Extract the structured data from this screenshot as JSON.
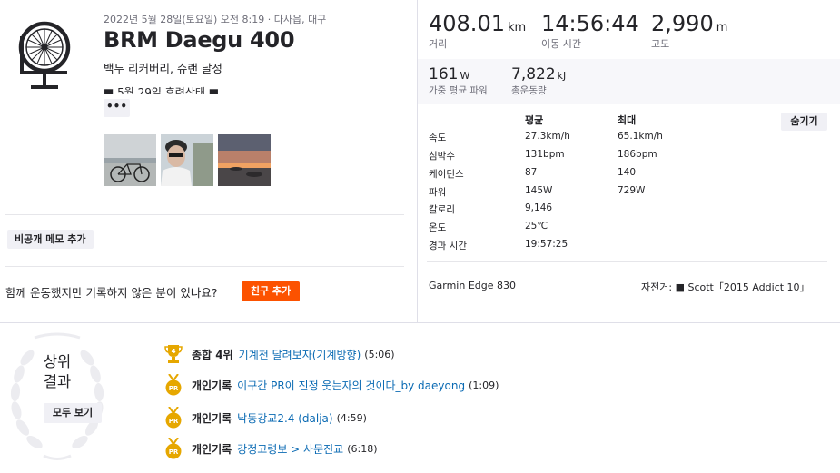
{
  "activity": {
    "datetime": "2022년 5월 28일(토요일) 오전 8:19 · 다사읍, 대구",
    "title": "BRM Daegu 400",
    "desc_line1": "백두 리커버리, 슈랜 달성",
    "desc_line2": "■ 5월 29일 후련상태 ■",
    "more_label": "•••",
    "private_note_label": "비공개 메모 추가",
    "together_text": "함께 운동했지만 기록하지 않은 분이 있나요?",
    "add_friend_label": "친구 추가"
  },
  "stats_primary": [
    {
      "value": "408.01",
      "unit": "km",
      "label": "거리"
    },
    {
      "value": "14:56:44",
      "unit": "",
      "label": "이동 시간"
    },
    {
      "value": "2,990",
      "unit": "m",
      "label": "고도"
    }
  ],
  "stats_secondary": [
    {
      "value": "161",
      "unit": "W",
      "label": "가중 평균 파워"
    },
    {
      "value": "7,822",
      "unit": "kJ",
      "label": "총운동량"
    }
  ],
  "details": {
    "hide_label": "숨기기",
    "headers": {
      "avg": "평균",
      "max": "최대"
    },
    "rows": [
      {
        "name": "속도",
        "avg": "27.3km/h",
        "max": "65.1km/h"
      },
      {
        "name": "심박수",
        "avg": "131bpm",
        "max": "186bpm"
      },
      {
        "name": "케이던스",
        "avg": "87",
        "max": "140"
      },
      {
        "name": "파워",
        "avg": "145W",
        "max": "729W"
      },
      {
        "name": "칼로리",
        "avg": "9,146",
        "max": ""
      },
      {
        "name": "온도",
        "avg": "25℃",
        "max": ""
      },
      {
        "name": "경과 시간",
        "avg": "19:57:25",
        "max": ""
      }
    ],
    "device": "Garmin Edge 830",
    "bike_label": "자전거:",
    "bike_value": "■ Scott「2015 Addict 10」"
  },
  "results": {
    "heading_line1": "상위",
    "heading_line2": "결과",
    "view_all_label": "모두 보기",
    "items": [
      {
        "medal": "4",
        "kind": "종합 4위",
        "segment": "기계천 달려보자(기계방향)",
        "time": "(5:06)"
      },
      {
        "medal": "PR",
        "kind": "개인기록",
        "segment": "이구간 PR이 진정 웃는자의 것이다_by daeyong",
        "time": "(1:09)"
      },
      {
        "medal": "PR",
        "kind": "개인기록",
        "segment": "낙동강교2.4 (dalja)",
        "time": "(4:59)"
      },
      {
        "medal": "PR",
        "kind": "개인기록",
        "segment": "강정고령보 > 사문진교",
        "time": "(6:18)"
      }
    ]
  },
  "colors": {
    "accent": "#fc5200",
    "link": "#0a6ab3",
    "medal_gold": "#e6a700"
  }
}
